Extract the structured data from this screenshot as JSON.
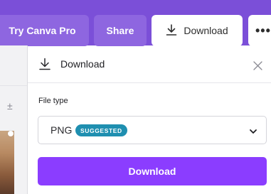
{
  "topbar": {
    "try_pro_label": "Try Canva Pro",
    "share_label": "Share",
    "download_label": "Download",
    "more_glyph": "•••"
  },
  "panel": {
    "title": "Download",
    "file_type_label": "File type",
    "selected_file_type": "PNG",
    "badge_label": "SUGGESTED",
    "download_button_label": "Download"
  },
  "sidebar": {
    "icon_glyph": "±"
  },
  "icons": {
    "download": "download-icon",
    "close": "close-icon",
    "chevron": "chevron-down-icon",
    "more": "more-options-icon"
  },
  "colors": {
    "brand_purple": "#7b4fd8",
    "button_purple": "#8b3dff",
    "badge_teal": "#1f8fb0"
  }
}
